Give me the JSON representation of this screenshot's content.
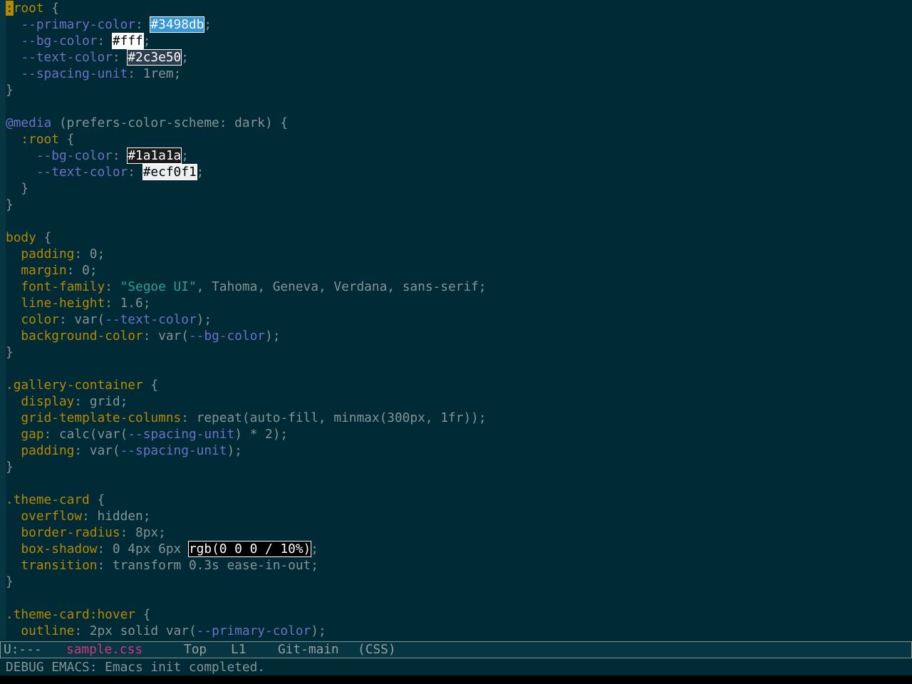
{
  "colors": {
    "background": "#002b36",
    "fringe": "#073642",
    "selector": "#b58900",
    "property": "#b58900",
    "variable": "#6c71c4",
    "string": "#2aa198",
    "plain": "#839496",
    "buffer_name": "#d33682"
  },
  "editor": {
    "lines": [
      [
        {
          "c": "cursor",
          "t": ":"
        },
        {
          "c": "sel",
          "t": "root"
        },
        {
          "c": "plain",
          "t": " {"
        }
      ],
      [
        {
          "c": "plain",
          "t": "  "
        },
        {
          "c": "var",
          "t": "--primary-color"
        },
        {
          "c": "plain",
          "t": ": "
        },
        {
          "c": "hex",
          "t": "#3498db",
          "bg": "#3498db",
          "fg": "#ffffff"
        },
        {
          "c": "plain",
          "t": ";"
        }
      ],
      [
        {
          "c": "plain",
          "t": "  "
        },
        {
          "c": "var",
          "t": "--bg-color"
        },
        {
          "c": "plain",
          "t": ": "
        },
        {
          "c": "hex",
          "t": "#fff",
          "bg": "#ffffff",
          "fg": "#000000"
        },
        {
          "c": "plain",
          "t": ";"
        }
      ],
      [
        {
          "c": "plain",
          "t": "  "
        },
        {
          "c": "var",
          "t": "--text-color"
        },
        {
          "c": "plain",
          "t": ": "
        },
        {
          "c": "hex",
          "t": "#2c3e50",
          "bg": "#2c3e50",
          "fg": "#ffffff"
        },
        {
          "c": "plain",
          "t": ";"
        }
      ],
      [
        {
          "c": "plain",
          "t": "  "
        },
        {
          "c": "var",
          "t": "--spacing-unit"
        },
        {
          "c": "plain",
          "t": ": 1rem;"
        }
      ],
      [
        {
          "c": "plain",
          "t": "}"
        }
      ],
      [
        {
          "c": "plain",
          "t": ""
        }
      ],
      [
        {
          "c": "at",
          "t": "@media"
        },
        {
          "c": "plain",
          "t": " (prefers-color-scheme: dark) {"
        }
      ],
      [
        {
          "c": "plain",
          "t": "  "
        },
        {
          "c": "sel",
          "t": ":root"
        },
        {
          "c": "plain",
          "t": " {"
        }
      ],
      [
        {
          "c": "plain",
          "t": "    "
        },
        {
          "c": "var",
          "t": "--bg-color"
        },
        {
          "c": "plain",
          "t": ": "
        },
        {
          "c": "hex",
          "t": "#1a1a1a",
          "bg": "#1a1a1a",
          "fg": "#ffffff"
        },
        {
          "c": "plain",
          "t": ";"
        }
      ],
      [
        {
          "c": "plain",
          "t": "    "
        },
        {
          "c": "var",
          "t": "--text-color"
        },
        {
          "c": "plain",
          "t": ": "
        },
        {
          "c": "hex",
          "t": "#ecf0f1",
          "bg": "#ecf0f1",
          "fg": "#000000"
        },
        {
          "c": "plain",
          "t": ";"
        }
      ],
      [
        {
          "c": "plain",
          "t": "  }"
        }
      ],
      [
        {
          "c": "plain",
          "t": "}"
        }
      ],
      [
        {
          "c": "plain",
          "t": ""
        }
      ],
      [
        {
          "c": "sel",
          "t": "body"
        },
        {
          "c": "plain",
          "t": " {"
        }
      ],
      [
        {
          "c": "plain",
          "t": "  "
        },
        {
          "c": "prop",
          "t": "padding"
        },
        {
          "c": "plain",
          "t": ": 0;"
        }
      ],
      [
        {
          "c": "plain",
          "t": "  "
        },
        {
          "c": "prop",
          "t": "margin"
        },
        {
          "c": "plain",
          "t": ": 0;"
        }
      ],
      [
        {
          "c": "plain",
          "t": "  "
        },
        {
          "c": "prop",
          "t": "font-family"
        },
        {
          "c": "plain",
          "t": ": "
        },
        {
          "c": "str",
          "t": "\"Segoe UI\""
        },
        {
          "c": "plain",
          "t": ", Tahoma, Geneva, Verdana, sans-serif;"
        }
      ],
      [
        {
          "c": "plain",
          "t": "  "
        },
        {
          "c": "prop",
          "t": "line-height"
        },
        {
          "c": "plain",
          "t": ": 1.6;"
        }
      ],
      [
        {
          "c": "plain",
          "t": "  "
        },
        {
          "c": "prop",
          "t": "color"
        },
        {
          "c": "plain",
          "t": ": var("
        },
        {
          "c": "var",
          "t": "--text-color"
        },
        {
          "c": "plain",
          "t": ");"
        }
      ],
      [
        {
          "c": "plain",
          "t": "  "
        },
        {
          "c": "prop",
          "t": "background-color"
        },
        {
          "c": "plain",
          "t": ": var("
        },
        {
          "c": "var",
          "t": "--bg-color"
        },
        {
          "c": "plain",
          "t": ");"
        }
      ],
      [
        {
          "c": "plain",
          "t": "}"
        }
      ],
      [
        {
          "c": "plain",
          "t": ""
        }
      ],
      [
        {
          "c": "sel",
          "t": ".gallery-container"
        },
        {
          "c": "plain",
          "t": " {"
        }
      ],
      [
        {
          "c": "plain",
          "t": "  "
        },
        {
          "c": "prop",
          "t": "display"
        },
        {
          "c": "plain",
          "t": ": grid;"
        }
      ],
      [
        {
          "c": "plain",
          "t": "  "
        },
        {
          "c": "prop",
          "t": "grid-template-columns"
        },
        {
          "c": "plain",
          "t": ": repeat(auto-fill, minmax(300px, 1fr));"
        }
      ],
      [
        {
          "c": "plain",
          "t": "  "
        },
        {
          "c": "prop",
          "t": "gap"
        },
        {
          "c": "plain",
          "t": ": calc(var("
        },
        {
          "c": "var",
          "t": "--spacing-unit"
        },
        {
          "c": "plain",
          "t": ") * 2);"
        }
      ],
      [
        {
          "c": "plain",
          "t": "  "
        },
        {
          "c": "prop",
          "t": "padding"
        },
        {
          "c": "plain",
          "t": ": var("
        },
        {
          "c": "var",
          "t": "--spacing-unit"
        },
        {
          "c": "plain",
          "t": ");"
        }
      ],
      [
        {
          "c": "plain",
          "t": "}"
        }
      ],
      [
        {
          "c": "plain",
          "t": ""
        }
      ],
      [
        {
          "c": "sel",
          "t": ".theme-card"
        },
        {
          "c": "plain",
          "t": " {"
        }
      ],
      [
        {
          "c": "plain",
          "t": "  "
        },
        {
          "c": "prop",
          "t": "overflow"
        },
        {
          "c": "plain",
          "t": ": hidden;"
        }
      ],
      [
        {
          "c": "plain",
          "t": "  "
        },
        {
          "c": "prop",
          "t": "border-radius"
        },
        {
          "c": "plain",
          "t": ": 8px;"
        }
      ],
      [
        {
          "c": "plain",
          "t": "  "
        },
        {
          "c": "prop",
          "t": "box-shadow"
        },
        {
          "c": "plain",
          "t": ": 0 4px 6px "
        },
        {
          "c": "hex",
          "t": "rgb(0 0 0 / 10%)",
          "bg": "#000000",
          "fg": "#ffffff"
        },
        {
          "c": "plain",
          "t": ";"
        }
      ],
      [
        {
          "c": "plain",
          "t": "  "
        },
        {
          "c": "prop",
          "t": "transition"
        },
        {
          "c": "plain",
          "t": ": transform 0.3s ease-in-out;"
        }
      ],
      [
        {
          "c": "plain",
          "t": "}"
        }
      ],
      [
        {
          "c": "plain",
          "t": ""
        }
      ],
      [
        {
          "c": "sel",
          "t": ".theme-card:hover"
        },
        {
          "c": "plain",
          "t": " {"
        }
      ],
      [
        {
          "c": "plain",
          "t": "  "
        },
        {
          "c": "prop",
          "t": "outline"
        },
        {
          "c": "plain",
          "t": ": 2px solid var("
        },
        {
          "c": "var",
          "t": "--primary-color"
        },
        {
          "c": "plain",
          "t": ");"
        }
      ]
    ]
  },
  "mode_line": {
    "status": "U:---",
    "buffer_name": "sample.css",
    "position": "Top",
    "line": "L1",
    "vc": "Git-main",
    "major_mode": "(CSS)"
  },
  "echo_area": {
    "message": "DEBUG EMACS: Emacs init completed."
  }
}
